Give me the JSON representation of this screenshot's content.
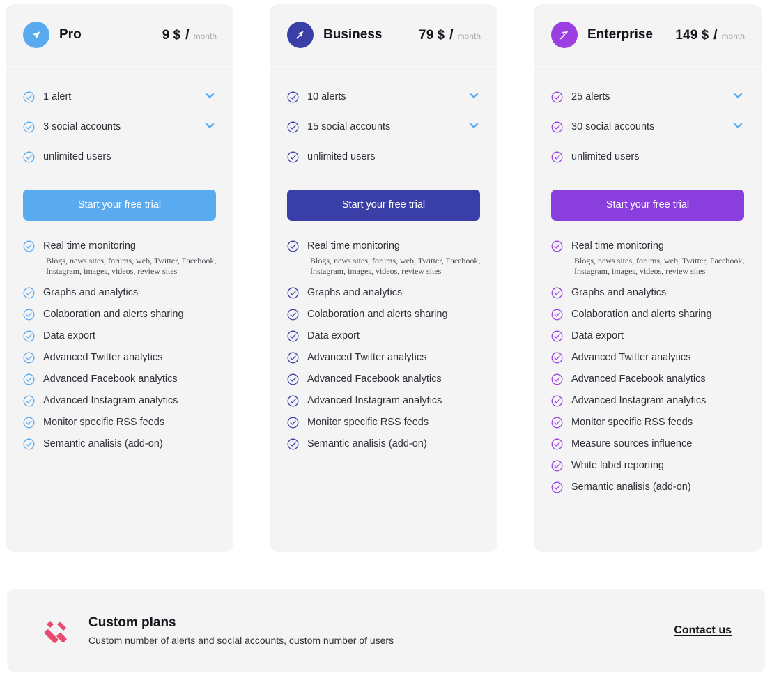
{
  "colors": {
    "page_bg": "#ffffff",
    "card_bg": "#f4f4f5",
    "pro_accent": "#5aaaf0",
    "business_accent": "#3a3fa8",
    "enterprise_accent": "#9b3fe0",
    "chevron": "#5aaaf0",
    "custom_icon": "#e94b6f",
    "text_primary": "#2f3138",
    "text_heading": "#15161c",
    "text_muted": "#a7a8ae"
  },
  "monitoring_sub": "Blogs, news sites, forums, web, Twitter, Facebook, Instagram, images, videos, review sites",
  "plans": [
    {
      "id": "pro",
      "icon": "arrow-send-icon",
      "name": "Pro",
      "price": "9",
      "currency": "$",
      "separator": "/",
      "period": "month",
      "accent": "#5aaaf0",
      "check_color": "#5aaaf0",
      "button_color": "#5aaaf0",
      "cta_label": "Start your free trial",
      "quotas": [
        {
          "label": "1 alert",
          "expandable": true
        },
        {
          "label": "3 social accounts",
          "expandable": true
        },
        {
          "label": "unlimited users",
          "expandable": false
        }
      ],
      "features": [
        {
          "label": "Real time monitoring",
          "sub": "Blogs, news sites, forums, web, Twitter, Facebook, Instagram, images, videos, review sites"
        },
        {
          "label": "Graphs and analytics"
        },
        {
          "label": "Colaboration and alerts sharing"
        },
        {
          "label": "Data export"
        },
        {
          "label": "Advanced Twitter analytics"
        },
        {
          "label": "Advanced Facebook analytics"
        },
        {
          "label": "Advanced Instagram analytics"
        },
        {
          "label": "Monitor specific RSS feeds"
        },
        {
          "label": "Semantic analisis (add-on)"
        }
      ]
    },
    {
      "id": "business",
      "icon": "arrow-up-right-icon",
      "name": "Business",
      "price": "79",
      "currency": "$",
      "separator": "/",
      "period": "month",
      "accent": "#3a3fa8",
      "check_color": "#3a3fa8",
      "button_color": "#3a3fa8",
      "cta_label": "Start your free trial",
      "quotas": [
        {
          "label": "10 alerts",
          "expandable": true
        },
        {
          "label": "15 social accounts",
          "expandable": true
        },
        {
          "label": "unlimited users",
          "expandable": false
        }
      ],
      "features": [
        {
          "label": "Real time monitoring",
          "sub": "Blogs, news sites, forums, web, Twitter, Facebook, Instagram, images, videos, review sites"
        },
        {
          "label": "Graphs and analytics"
        },
        {
          "label": "Colaboration and alerts sharing"
        },
        {
          "label": "Data export"
        },
        {
          "label": "Advanced Twitter analytics"
        },
        {
          "label": "Advanced Facebook analytics"
        },
        {
          "label": "Advanced Instagram analytics"
        },
        {
          "label": "Monitor specific RSS feeds"
        },
        {
          "label": "Semantic analisis (add-on)"
        }
      ]
    },
    {
      "id": "enterprise",
      "icon": "arrows-stacked-icon",
      "name": "Enterprise",
      "price": "149",
      "currency": "$",
      "separator": "/",
      "period": "month",
      "accent": "#9b3fe0",
      "check_color": "#9b3fe0",
      "button_color": "#8b3ede",
      "cta_label": "Start your free trial",
      "quotas": [
        {
          "label": "25 alerts",
          "expandable": true
        },
        {
          "label": "30 social accounts",
          "expandable": true
        },
        {
          "label": "unlimited users",
          "expandable": false
        }
      ],
      "features": [
        {
          "label": "Real time monitoring",
          "sub": "Blogs, news sites, forums, web, Twitter, Facebook, Instagram, images, videos, review sites"
        },
        {
          "label": "Graphs and analytics"
        },
        {
          "label": "Colaboration and alerts sharing"
        },
        {
          "label": "Data export"
        },
        {
          "label": "Advanced Twitter analytics"
        },
        {
          "label": "Advanced Facebook analytics"
        },
        {
          "label": "Advanced Instagram analytics"
        },
        {
          "label": "Monitor specific RSS feeds"
        },
        {
          "label": "Measure sources influence"
        },
        {
          "label": "White label reporting"
        },
        {
          "label": "Semantic analisis (add-on)"
        }
      ]
    }
  ],
  "custom": {
    "icon": "pencil-ruler-icon",
    "title": "Custom plans",
    "subtitle": "Custom number of alerts and social accounts, custom number of users",
    "contact_label": "Contact us"
  }
}
